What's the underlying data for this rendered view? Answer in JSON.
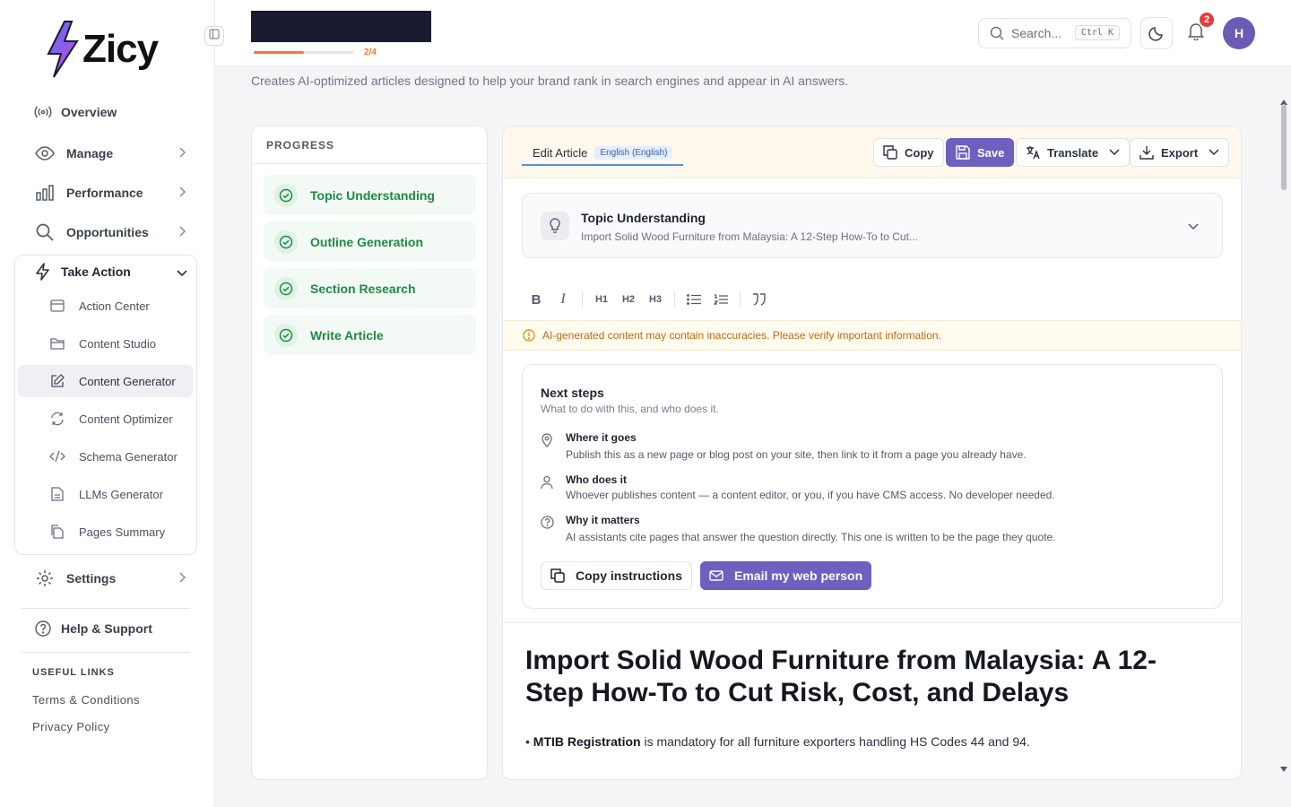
{
  "brand": {
    "name": "Zicy",
    "accent": "#6f5fbf"
  },
  "sidebar": {
    "items": [
      {
        "label": "Overview",
        "icon": "broadcast-icon"
      },
      {
        "label": "Manage",
        "icon": "eye-icon"
      },
      {
        "label": "Performance",
        "icon": "bar-chart-icon"
      },
      {
        "label": "Opportunities",
        "icon": "search-icon"
      },
      {
        "label": "Take Action",
        "icon": "lightning-icon"
      },
      {
        "label": "Settings",
        "icon": "gear-icon"
      },
      {
        "label": "Help & Support",
        "icon": "help-circle-icon"
      }
    ],
    "sub_items": [
      {
        "label": "Action Center",
        "icon": "calendar-icon"
      },
      {
        "label": "Content Studio",
        "icon": "folder-icon"
      },
      {
        "label": "Content Generator",
        "icon": "edit-icon"
      },
      {
        "label": "Content Optimizer",
        "icon": "refresh-icon"
      },
      {
        "label": "Schema Generator",
        "icon": "code-icon"
      },
      {
        "label": "LLMs Generator",
        "icon": "file-icon"
      },
      {
        "label": "Pages Summary",
        "icon": "files-icon"
      }
    ],
    "useful_links_title": "USEFUL LINKS",
    "useful_links": [
      "Terms & Conditions",
      "Privacy Policy"
    ]
  },
  "header": {
    "progress": {
      "label": "2/4",
      "fraction": 0.5
    },
    "search_placeholder": "Search...",
    "search_shortcut": "Ctrl K",
    "notification_count": "2",
    "avatar_initial": "H"
  },
  "subtitle": "Creates AI-optimized articles designed to help your brand rank in search engines and appear in AI answers.",
  "progress_panel": {
    "title": "PROGRESS",
    "steps": [
      "Topic Understanding",
      "Outline Generation",
      "Section Research",
      "Write Article"
    ]
  },
  "editor": {
    "tab_label": "Edit Article",
    "language": "English (English)",
    "buttons": {
      "copy": "Copy",
      "save": "Save",
      "translate": "Translate",
      "export": "Export"
    },
    "topic": {
      "title": "Topic Understanding",
      "summary": "Import Solid Wood Furniture from Malaysia: A 12-Step How-To to Cut..."
    },
    "format_tools": [
      "B",
      "I",
      "H1",
      "H2",
      "H3"
    ],
    "warning": "AI-generated content may contain inaccuracies. Please verify important information.",
    "next_steps": {
      "title": "Next steps",
      "subtitle": "What to do with this, and who does it.",
      "items": [
        {
          "heading": "Where it goes",
          "detail": "Publish this as a new page or blog post on your site, then link to it from a page you already have."
        },
        {
          "heading": "Who does it",
          "detail": "Whoever publishes content — a content editor, or you, if you have CMS access. No developer needed."
        },
        {
          "heading": "Why it matters",
          "detail": "AI assistants cite pages that answer the question directly. This one is written to be the page they quote."
        }
      ],
      "copy_button": "Copy instructions",
      "email_button": "Email my web person"
    },
    "article": {
      "title": "Import Solid Wood Furniture from Malaysia: A 12-Step How-To to Cut Risk, Cost, and Delays",
      "bullet_bold": "MTIB Registration",
      "bullet_rest": " is mandatory for all furniture exporters handling HS Codes 44 and 94."
    }
  }
}
